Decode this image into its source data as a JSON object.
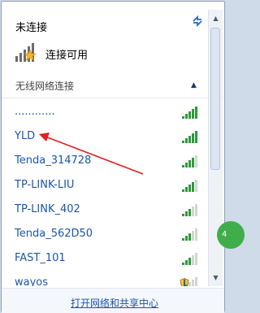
{
  "header": {
    "title": "未连接",
    "connection_status": "连接可用"
  },
  "section": {
    "title": "无线网络连接"
  },
  "networks": [
    {
      "name": "............",
      "secured": false
    },
    {
      "name": "YLD",
      "secured": false
    },
    {
      "name": "Tenda_314728",
      "secured": false
    },
    {
      "name": "TP-LINK-LIU",
      "secured": false
    },
    {
      "name": "TP-LINK_402",
      "secured": false
    },
    {
      "name": "Tenda_562D50",
      "secured": false
    },
    {
      "name": "FAST_101",
      "secured": false
    },
    {
      "name": "wayos",
      "secured": true
    }
  ],
  "footer": {
    "link": "打开网络和共享中心"
  },
  "badge": {
    "text": "4"
  },
  "colors": {
    "link_blue": "#1b56a8",
    "signal_green": "#2e9a3a",
    "arrow_red": "#e02020"
  },
  "icons": {
    "refresh": "refresh-arrows-icon",
    "connection": "signal-bars-star-icon",
    "collapse": "chevron-up-icon",
    "signal": "wifi-signal-icon",
    "shield": "security-shield-icon"
  }
}
